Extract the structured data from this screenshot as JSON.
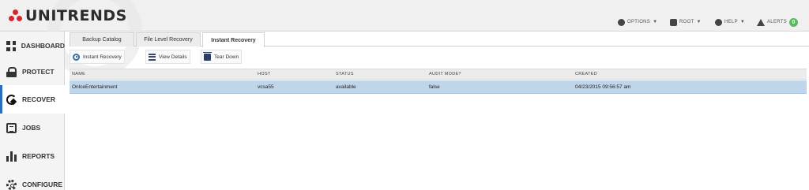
{
  "brand": {
    "logo_text": "UNITRENDS",
    "accent": "#d8262f"
  },
  "topnav": {
    "options": "OPTIONS",
    "user": "ROOT",
    "help": "HELP",
    "alerts": "ALERTS",
    "alerts_count": "0"
  },
  "sidebar": {
    "items": [
      {
        "label": "DASHBOARD",
        "icon": "dashboard-grid-icon"
      },
      {
        "label": "PROTECT",
        "icon": "lock-icon"
      },
      {
        "label": "RECOVER",
        "icon": "recover-icon",
        "active": true
      },
      {
        "label": "JOBS",
        "icon": "jobs-list-icon"
      },
      {
        "label": "REPORTS",
        "icon": "bar-chart-icon"
      },
      {
        "label": "CONFIGURE",
        "icon": "gear-icon"
      }
    ]
  },
  "tabs": [
    {
      "label": "Backup Catalog"
    },
    {
      "label": "File Level Recovery"
    },
    {
      "label": "Instant Recovery",
      "active": true
    }
  ],
  "toolbar": {
    "instant_recovery": "Instant Recovery",
    "view_details": "View Details",
    "tear_down": "Tear Down"
  },
  "table": {
    "columns": [
      "NAME",
      "HOST",
      "STATUS",
      "AUDIT MODE?",
      "CREATED"
    ],
    "rows": [
      {
        "name": "OnlceEntertainment",
        "host": "vcsa55",
        "status": "available",
        "audit_mode": "false",
        "created": "04/23/2015 09:56:57 am"
      }
    ],
    "selected_row_color": "#bfd5ea"
  }
}
